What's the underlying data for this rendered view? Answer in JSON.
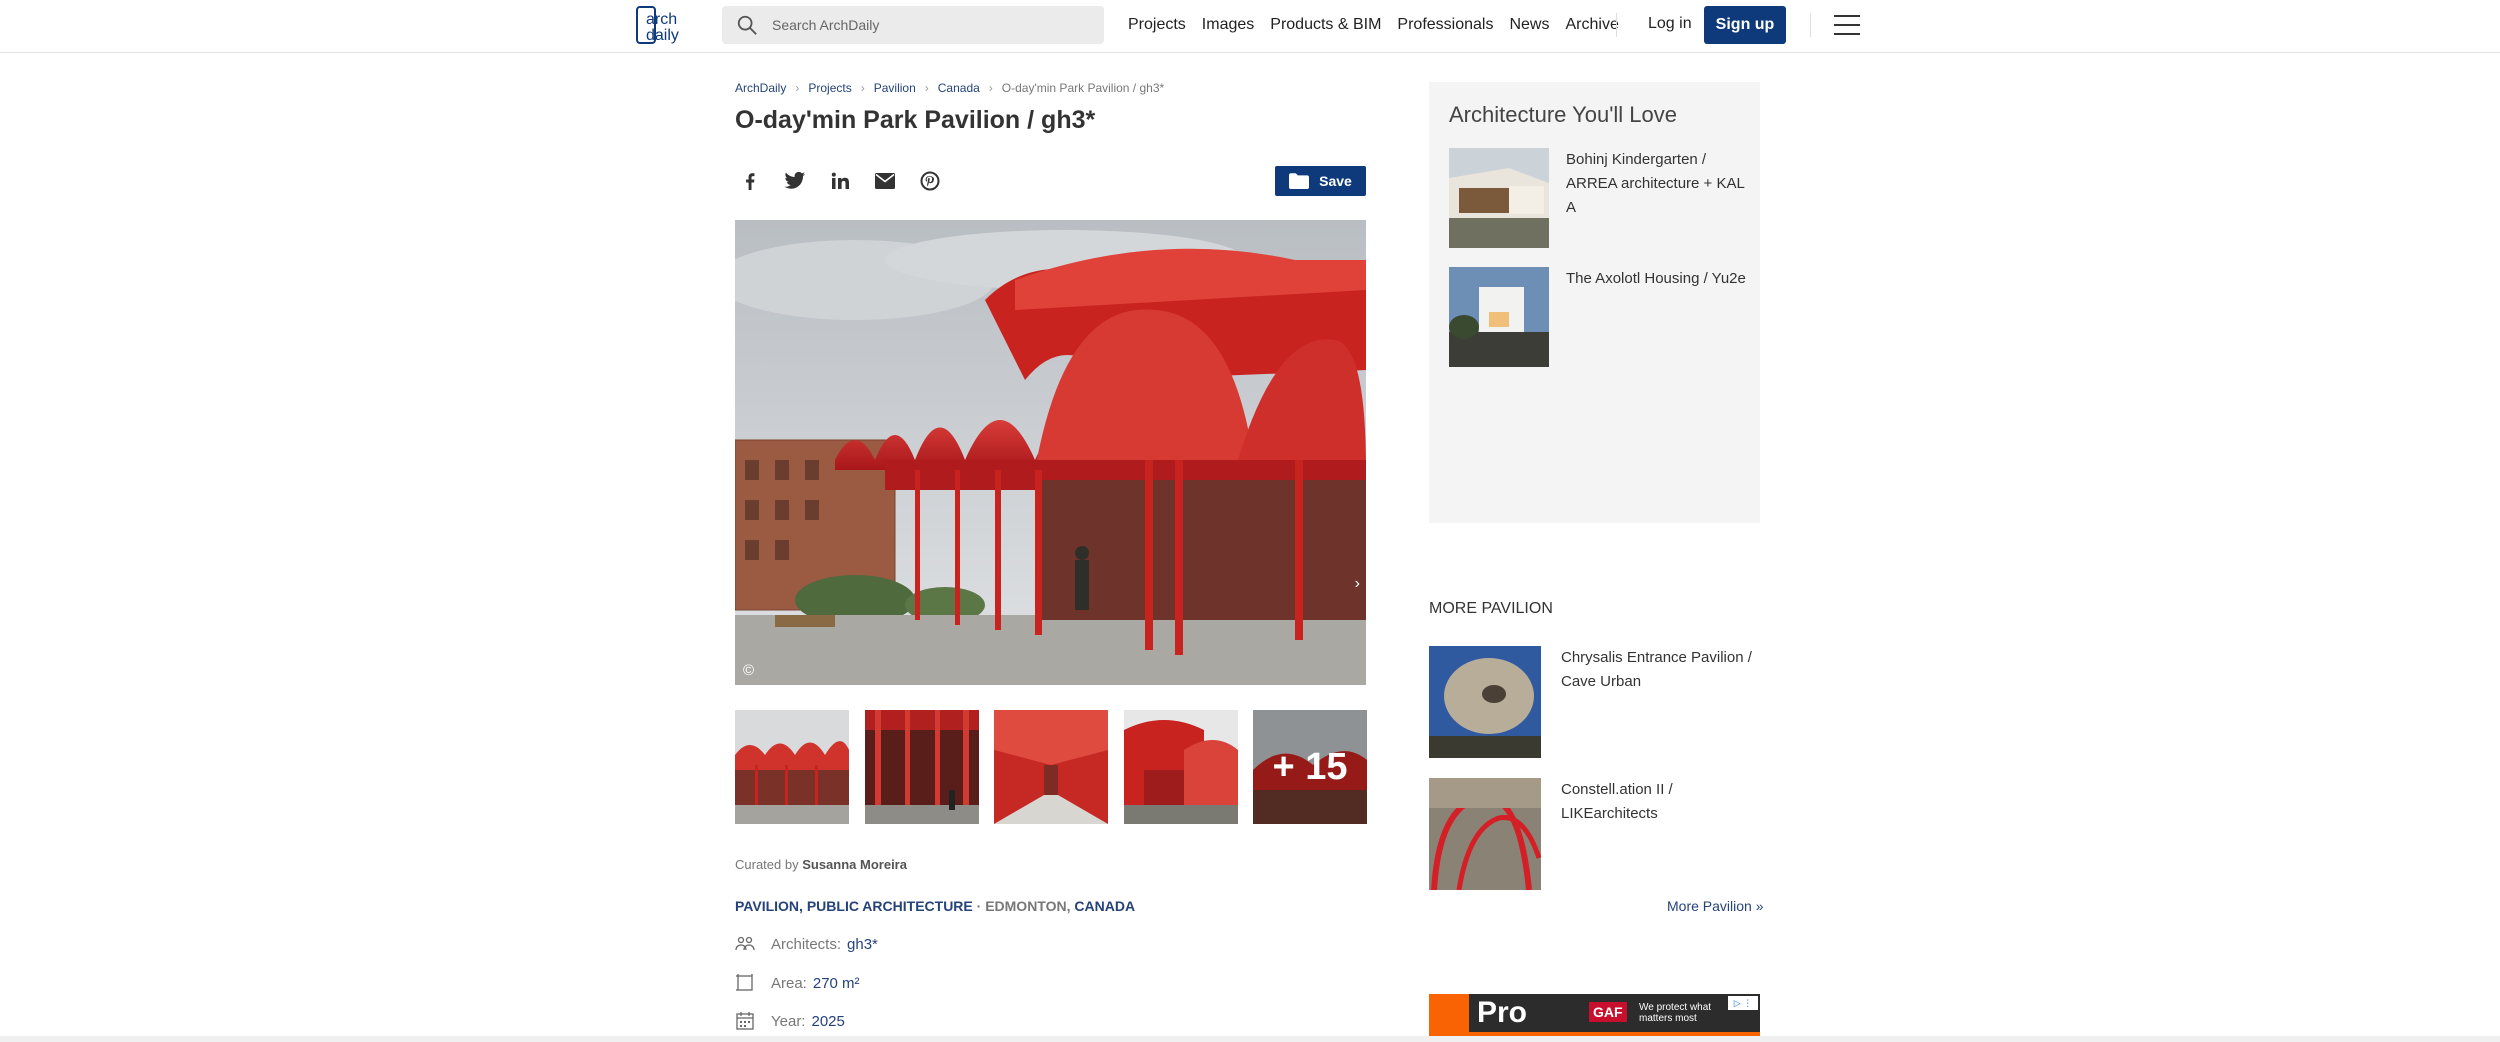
{
  "header": {
    "logo_text": "arch daily",
    "search_placeholder": "Search ArchDaily",
    "nav": [
      "Projects",
      "Images",
      "Products & BIM",
      "Professionals",
      "News",
      "Archive"
    ],
    "login": "Log in",
    "signup": "Sign up"
  },
  "breadcrumb": [
    "ArchDaily",
    "Projects",
    "Pavilion",
    "Canada",
    "O-day'min Park Pavilion / gh3*"
  ],
  "title": "O-day'min Park Pavilion / gh3*",
  "share_icons": [
    "facebook-icon",
    "twitter-icon",
    "linkedin-icon",
    "email-icon",
    "pinterest-icon"
  ],
  "save_label": "Save",
  "image": {
    "copyright": "©"
  },
  "thumbs": {
    "more_label": "+ 15"
  },
  "curated": {
    "prefix": "Curated by",
    "name": "Susanna Moreira"
  },
  "categories": {
    "cat1": "PAVILION",
    "comma1": ", ",
    "cat2": "PUBLIC ARCHITECTURE",
    "sep": " · EDMONTON, ",
    "country": "CANADA"
  },
  "specs": {
    "architects_label": "Architects:",
    "architects_value": "gh3*",
    "area_label": "Area:",
    "area_value": "270 m²",
    "year_label": "Year:",
    "year_value": "2025"
  },
  "sidebar": {
    "love_title": "Architecture You'll Love",
    "love_items": [
      {
        "title": "Bohinj Kindergarten / ARREA architecture + KAL A"
      },
      {
        "title": "The Axolotl Housing / Yu2e"
      }
    ],
    "more_title": "MORE PAVILION",
    "more_items": [
      {
        "title": "Chrysalis Entrance Pavilion / Cave Urban"
      },
      {
        "title": "Constell.ation II / LIKEarchitects"
      }
    ],
    "more_link": "More Pavilion »"
  },
  "ad": {
    "brand": "Pro",
    "gaf": "GAF",
    "tagline": "We protect what matters most"
  },
  "colors": {
    "brand_blue": "#0e3a7b",
    "link_blue": "#25437a",
    "pavilion_red": "#c8231f"
  }
}
